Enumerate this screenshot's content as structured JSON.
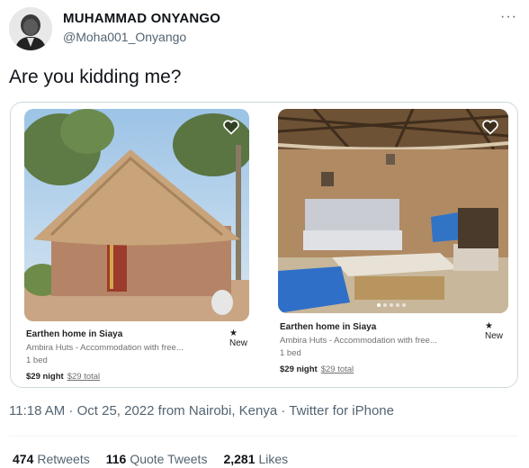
{
  "author": {
    "name": "MUHAMMAD ONYANGO",
    "handle": "@Moha001_Onyango"
  },
  "more_label": "···",
  "tweet_text": "Are you kidding me?",
  "listings": [
    {
      "title": "Earthen home in Siaya",
      "badge": "★ New",
      "host": "Ambira Huts - Accommodation with free...",
      "beds": "1 bed",
      "price_night": "$29 night",
      "price_total": "$29 total"
    },
    {
      "title": "Earthen home in Siaya",
      "badge": "★ New",
      "host": "Ambira Huts - Accommodation with free...",
      "beds": "1 bed",
      "price_night": "$29 night",
      "price_total": "$29 total"
    }
  ],
  "meta": "11:18 AM · Oct 25, 2022 from Nairobi, Kenya · Twitter for iPhone",
  "stats": {
    "retweets_count": "474",
    "retweets_label": "Retweets",
    "quotes_count": "116",
    "quotes_label": "Quote Tweets",
    "likes_count": "2,281",
    "likes_label": "Likes"
  },
  "colors": {
    "text_primary": "#0f1419",
    "text_secondary": "#536471",
    "border": "#cfd9de"
  }
}
